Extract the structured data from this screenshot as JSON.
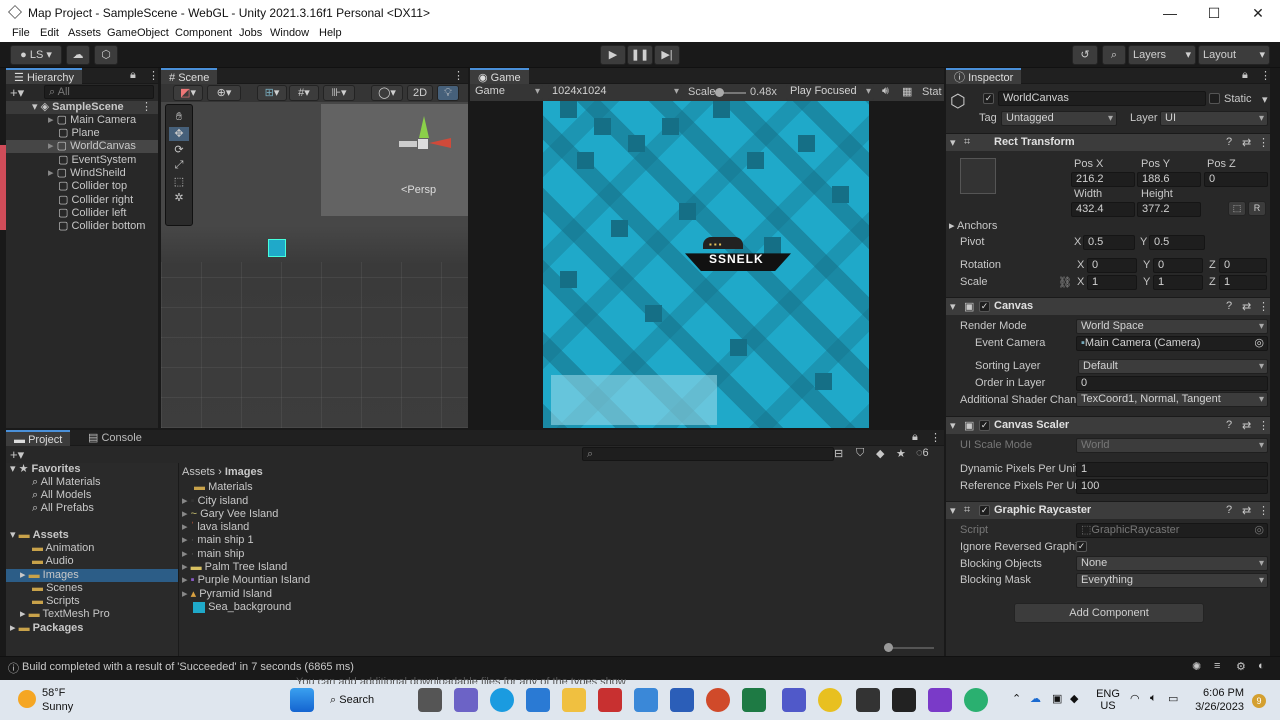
{
  "window": {
    "title": "Map Project - SampleScene - WebGL - Unity 2021.3.16f1 Personal <DX11>",
    "min": "—",
    "max": "☐",
    "close": "✕"
  },
  "menu": [
    "File",
    "Edit",
    "Assets",
    "GameObject",
    "Component",
    "Jobs",
    "Window",
    "Help"
  ],
  "toolbar": {
    "account": "LS",
    "layers": "Layers",
    "layout": "Layout"
  },
  "hierarchy": {
    "tab": "Hierarchy",
    "search_placeholder": "All",
    "scene": "SampleScene",
    "items": [
      "Main Camera",
      "Plane",
      "WorldCanvas",
      "EventSystem",
      "WindSheild",
      "Collider top",
      "Collider right",
      "Collider left",
      "Collider bottom"
    ]
  },
  "scene": {
    "tab": "Scene",
    "mode2d": "2D",
    "persp": "<Persp"
  },
  "game": {
    "tab": "Game",
    "display": "Game",
    "resolution": "1024x1024",
    "scale_label": "Scale",
    "scale_value": "0.48x",
    "play_mode": "Play Focused",
    "stats": "Stat",
    "logo_text": "SSNELK",
    "scale_level": 0.05
  },
  "inspector": {
    "tab": "Inspector",
    "object_name": "WorldCanvas",
    "static": "Static",
    "tag_label": "Tag",
    "tag": "Untagged",
    "layer_label": "Layer",
    "layer": "UI",
    "rect": {
      "title": "Rect Transform",
      "posx_l": "Pos X",
      "posy_l": "Pos Y",
      "posz_l": "Pos Z",
      "posx": "216.2",
      "posy": "188.6",
      "posz": "0",
      "width_l": "Width",
      "height_l": "Height",
      "width": "432.4",
      "height": "377.2",
      "anchors": "Anchors",
      "pivot": "Pivot",
      "pivot_x": "0.5",
      "pivot_y": "0.5",
      "rotation": "Rotation",
      "rot_x": "0",
      "rot_y": "0",
      "rot_z": "0",
      "scale": "Scale",
      "scale_x": "1",
      "scale_y": "1",
      "scale_z": "1",
      "x": "X",
      "y": "Y",
      "z": "Z",
      "r": "R"
    },
    "canvas": {
      "title": "Canvas",
      "render_mode_l": "Render Mode",
      "render_mode": "World Space",
      "event_camera_l": "Event Camera",
      "event_camera": "Main Camera (Camera)",
      "sorting_layer_l": "Sorting Layer",
      "sorting_layer": "Default",
      "order_l": "Order in Layer",
      "order": "0",
      "shader_l": "Additional Shader Chan",
      "shader": "TexCoord1, Normal, Tangent"
    },
    "scaler": {
      "title": "Canvas Scaler",
      "ui_scale_l": "UI Scale Mode",
      "ui_scale": "World",
      "dpu_l": "Dynamic Pixels Per Unit",
      "dpu": "1",
      "rppu_l": "Reference Pixels Per Ur",
      "rppu": "100"
    },
    "raycaster": {
      "title": "Graphic Raycaster",
      "script_l": "Script",
      "script": "GraphicRaycaster",
      "ignore_l": "Ignore Reversed Graphi",
      "blocking_objects_l": "Blocking Objects",
      "blocking_objects": "None",
      "blocking_mask_l": "Blocking Mask",
      "blocking_mask": "Everything"
    },
    "add_component": "Add Component"
  },
  "project": {
    "tab_project": "Project",
    "tab_console": "Console",
    "favorites": "Favorites",
    "fav_items": [
      "All Materials",
      "All Models",
      "All Prefabs"
    ],
    "assets": "Assets",
    "asset_folders": [
      "Animation",
      "Audio",
      "Images",
      "Scenes",
      "Scripts",
      "TextMesh Pro"
    ],
    "packages": "Packages",
    "breadcrumb_root": "Assets",
    "breadcrumb_sep": "›",
    "breadcrumb_current": "Images",
    "files": [
      "Materials",
      "City island",
      "Gary Vee Island",
      "lava island",
      "main ship 1",
      "main ship",
      "Palm Tree Island",
      "Purple Mountian Island",
      "Pyramid Island",
      "Sea_background"
    ],
    "hidden_count": "6"
  },
  "status": {
    "message": "Build completed with a result of 'Succeeded' in 7 seconds (6865 ms)"
  },
  "taskbar": {
    "temp": "58°F",
    "weather": "Sunny",
    "search": "Search",
    "lang1": "ENG",
    "lang2": "US",
    "time": "6:06 PM",
    "date": "3/26/2023",
    "notif": "9",
    "toast": "You can add additional downloadable files for any of the types show"
  },
  "colors": {
    "accent": "#4a90d9",
    "sea_light": "#1fa9c9",
    "sea_dark": "#156f86",
    "selection": "#2c5d87"
  }
}
